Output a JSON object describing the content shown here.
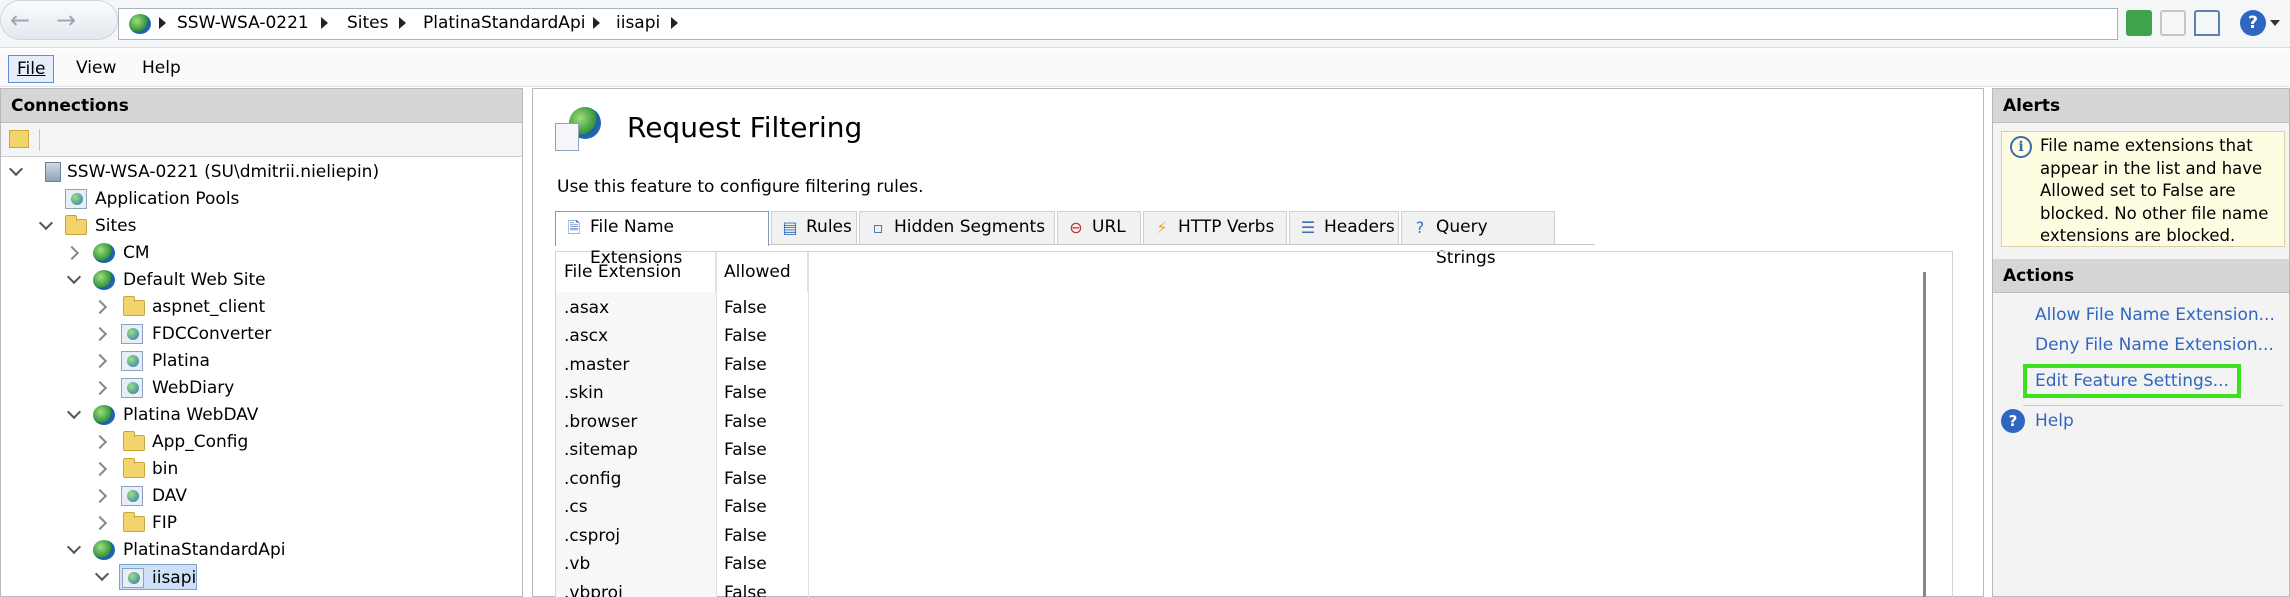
{
  "address_bar": {
    "crumbs": [
      "SSW-WSA-0221",
      "Sites",
      "PlatinaStandardApi",
      "iisapi"
    ]
  },
  "menubar": {
    "file": "File",
    "view": "View",
    "help": "Help"
  },
  "connections": {
    "title": "Connections",
    "tree": {
      "server": "SSW-WSA-0221 (SU\\dmitrii.nieliepin)",
      "app_pools": "Application Pools",
      "sites": "Sites",
      "cm": "CM",
      "default_site": "Default Web Site",
      "aspnet_client": "aspnet_client",
      "fdcconverter": "FDCConverter",
      "platina": "Platina",
      "webdiary": "WebDiary",
      "platina_webdav": "Platina WebDAV",
      "app_config": "App_Config",
      "bin": "bin",
      "dav": "DAV",
      "fip": "FIP",
      "platina_standard_api": "PlatinaStandardApi",
      "iisapi": "iisapi"
    }
  },
  "main": {
    "title": "Request Filtering",
    "description": "Use this feature to configure filtering rules.",
    "tabs": [
      "File Name Extensions",
      "Rules",
      "Hidden Segments",
      "URL",
      "HTTP Verbs",
      "Headers",
      "Query Strings"
    ],
    "columns": [
      "File Extension",
      "Allowed"
    ],
    "rows": [
      {
        "ext": ".asax",
        "allowed": "False"
      },
      {
        "ext": ".ascx",
        "allowed": "False"
      },
      {
        "ext": ".master",
        "allowed": "False"
      },
      {
        "ext": ".skin",
        "allowed": "False"
      },
      {
        "ext": ".browser",
        "allowed": "False"
      },
      {
        "ext": ".sitemap",
        "allowed": "False"
      },
      {
        "ext": ".config",
        "allowed": "False"
      },
      {
        "ext": ".cs",
        "allowed": "False"
      },
      {
        "ext": ".csproj",
        "allowed": "False"
      },
      {
        "ext": ".vb",
        "allowed": "False"
      },
      {
        "ext": ".vbproj",
        "allowed": "False"
      }
    ]
  },
  "alerts": {
    "title": "Alerts",
    "message": "File name extensions that appear in the list and have Allowed set to False are blocked. No other file name extensions are blocked."
  },
  "actions": {
    "title": "Actions",
    "allow": "Allow File Name Extension...",
    "deny": "Deny File Name Extension...",
    "edit": "Edit Feature Settings...",
    "help": "Help"
  },
  "colors": {
    "link": "#2f66c1",
    "highlight": "#3ce21e"
  }
}
